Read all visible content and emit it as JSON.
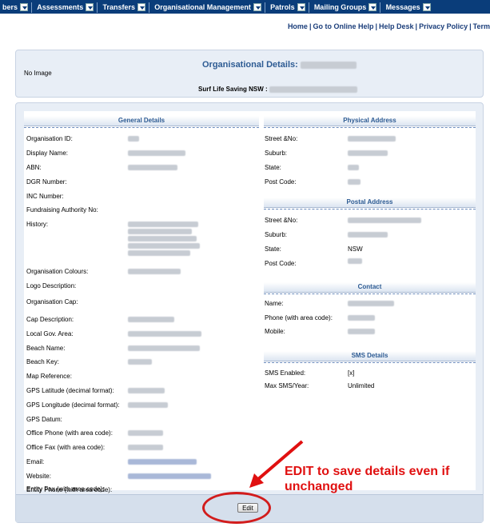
{
  "nav": {
    "items": [
      {
        "label": "bers"
      },
      {
        "label": "Assessments"
      },
      {
        "label": "Transfers"
      },
      {
        "label": "Organisational Management"
      },
      {
        "label": "Patrols"
      },
      {
        "label": "Mailing Groups"
      },
      {
        "label": "Messages"
      }
    ]
  },
  "toplinks": {
    "home": "Home",
    "online_help": "Go to Online Help",
    "help_desk": "Help Desk",
    "privacy": "Privacy Policy",
    "terms": "Term"
  },
  "header": {
    "no_image": "No Image",
    "title": "Organisational Details:",
    "org_prefix": "Surf Life Saving NSW :"
  },
  "general": {
    "heading": "General Details",
    "fields": [
      {
        "label": "Organisation ID:"
      },
      {
        "label": "Display Name:"
      },
      {
        "label": "ABN:"
      },
      {
        "label": "DGR Number:"
      },
      {
        "label": "INC Number:"
      },
      {
        "label": "Fundraising Authority No:"
      },
      {
        "label": "History:"
      },
      {
        "label": "Organisation Colours:"
      },
      {
        "label": "Logo Description:"
      },
      {
        "label": "Organisation Cap:"
      },
      {
        "label": "Cap Description:"
      },
      {
        "label": "Local Gov. Area:"
      },
      {
        "label": "Beach Name:"
      },
      {
        "label": "Beach Key:"
      },
      {
        "label": "Map Reference:"
      },
      {
        "label": "GPS Latitude (decimal format):"
      },
      {
        "label": "GPS Longitude (decimal format):"
      },
      {
        "label": "GPS Datum:"
      },
      {
        "label": "Office Phone (with area code):"
      },
      {
        "label": "Office Fax (with area code):"
      },
      {
        "label": "Email:"
      },
      {
        "label": "Website:"
      },
      {
        "label": "Entity Phone (with area code):"
      },
      {
        "label": "Entity Fax (with area code):"
      }
    ]
  },
  "physical": {
    "heading": "Physical Address",
    "fields": [
      {
        "label": "Street &No:"
      },
      {
        "label": "Suburb:"
      },
      {
        "label": "State:"
      },
      {
        "label": "Post Code:"
      }
    ]
  },
  "postal": {
    "heading": "Postal Address",
    "fields": [
      {
        "label": "Street &No:"
      },
      {
        "label": "Suburb:"
      },
      {
        "label": "State:",
        "value": "NSW"
      },
      {
        "label": "Post Code:"
      }
    ]
  },
  "contact": {
    "heading": "Contact",
    "fields": [
      {
        "label": "Name:"
      },
      {
        "label": "Phone (with area code):"
      },
      {
        "label": "Mobile:"
      }
    ]
  },
  "sms": {
    "heading": "SMS Details",
    "fields": [
      {
        "label": "SMS Enabled:",
        "value": "[x]"
      },
      {
        "label": "Max SMS/Year:",
        "value": "Unlimited"
      }
    ]
  },
  "edit_button": "Edit",
  "annotation": {
    "line1": "EDIT to save details even if",
    "line2": "unchanged"
  },
  "colors": {
    "nav_bg": "#0a3d7a",
    "accent": "#2d5b93",
    "annotation": "#e01010"
  }
}
